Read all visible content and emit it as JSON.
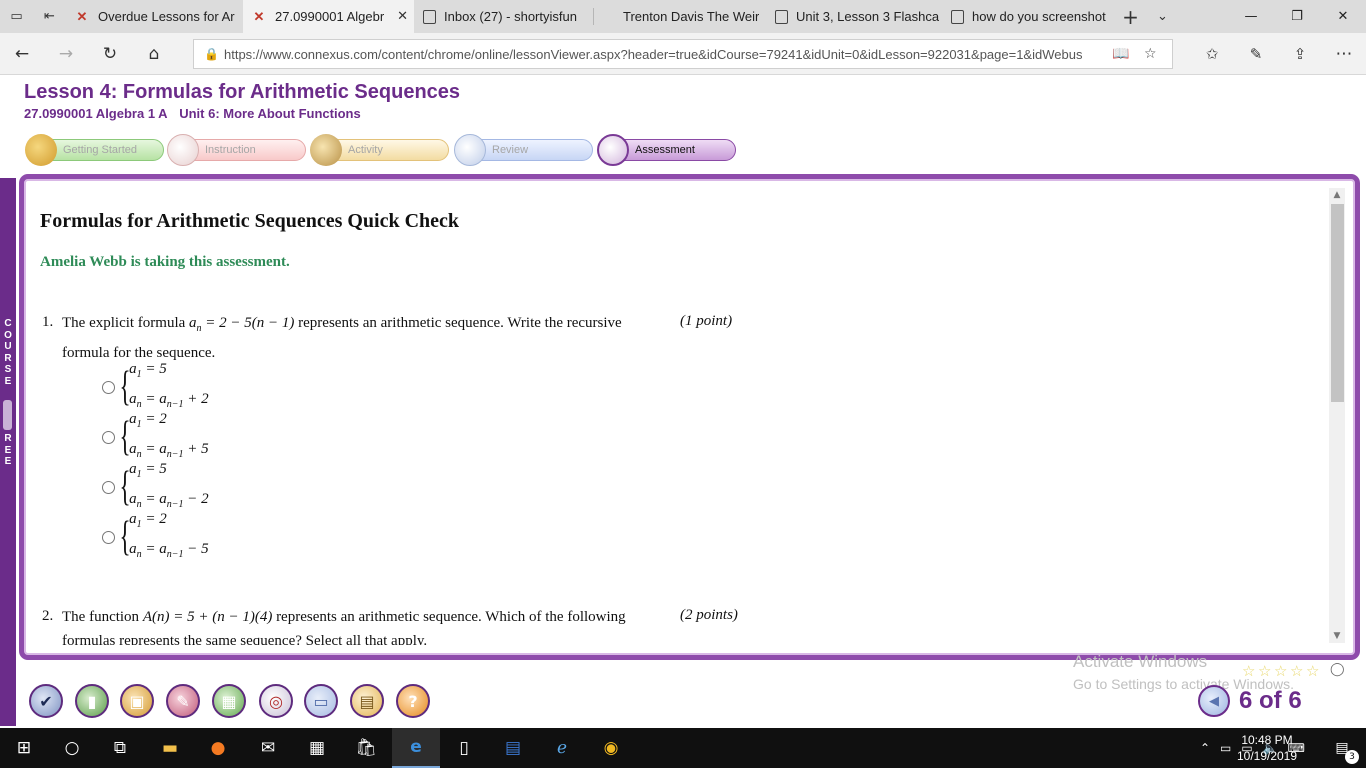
{
  "browser": {
    "tabs": [
      {
        "title": "Overdue Lessons for Ar",
        "icon": "connexus-icon"
      },
      {
        "title": "27.0990001 Algebr",
        "icon": "connexus-icon",
        "active": true
      },
      {
        "title": "Inbox (27) - shortyisfun",
        "icon": "page-icon"
      },
      {
        "title": "Trenton Davis The Weir",
        "icon": "none"
      },
      {
        "title": "Unit 3, Lesson 3 Flashca",
        "icon": "page-icon"
      },
      {
        "title": "how do you screenshot",
        "icon": "page-icon"
      }
    ],
    "url": "https://www.connexus.com/content/chrome/online/lessonViewer.aspx?header=true&idCourse=79241&idUnit=0&idLesson=922031&page=1&idWebus"
  },
  "lesson": {
    "title": "Lesson 4: Formulas for Arithmetic Sequences",
    "course": "27.0990001 Algebra 1 A",
    "unit": "Unit 6: More About Functions"
  },
  "steps": {
    "getting_started": "Getting Started",
    "instruction": "Instruction",
    "activity": "Activity",
    "review": "Review",
    "assessment": "Assessment"
  },
  "course_tree_label": "COURSE TREE",
  "quick_check": {
    "title": "Formulas for Arithmetic Sequences Quick Check",
    "taking": "Amelia Webb is taking this assessment.",
    "q1": {
      "number": "1.",
      "text_before": "The explicit formula",
      "formula_a": "a",
      "formula_sub": "n",
      "formula_rest": " = 2 − 5(n − 1)",
      "text_after": "represents an arithmetic sequence. Write the recursive",
      "text_line2": "formula for the sequence.",
      "points": "(1 point)",
      "options": [
        {
          "first": "= 5",
          "second": "+ 2"
        },
        {
          "first": "= 2",
          "second": "+ 5"
        },
        {
          "first": "= 5",
          "second": "− 2"
        },
        {
          "first": "= 2",
          "second": "− 5"
        }
      ]
    },
    "q2": {
      "number": "2.",
      "text_before": "The function",
      "formula": "A(n) = 5 + (n − 1)(4)",
      "text_after": "represents an arithmetic sequence. Which of the following",
      "text_line2": "formulas represents the same sequence? Select all that apply.",
      "points": "(2 points)"
    }
  },
  "watermark": {
    "line1": "Activate Windows",
    "line2": "Go to Settings to activate Windows."
  },
  "pager": {
    "text": "6 of 6"
  },
  "taskbar": {
    "time": "10:48 PM",
    "date": "10/19/2019",
    "notifications": "3"
  }
}
